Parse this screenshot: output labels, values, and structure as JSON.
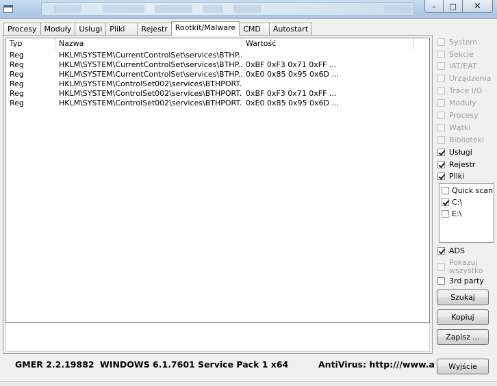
{
  "titlebar": {
    "buttons": {
      "minimize": "–",
      "maximize": "□",
      "close": "✕"
    }
  },
  "tabs": [
    {
      "label": "Procesy",
      "active": false
    },
    {
      "label": "Moduły",
      "active": false
    },
    {
      "label": "Usługi",
      "active": false
    },
    {
      "label": "Pliki",
      "active": false
    },
    {
      "label": "Rejestr",
      "active": false
    },
    {
      "label": "Rootkit/Malware",
      "active": true
    },
    {
      "label": "CMD",
      "active": false
    },
    {
      "label": "Autostart",
      "active": false
    }
  ],
  "list": {
    "columns": {
      "typ": "Typ",
      "nazwa": "Nazwa",
      "wartosc": "Wartość"
    },
    "rows": [
      {
        "typ": "Reg",
        "nazwa": "HKLM\\SYSTEM\\CurrentControlSet\\services\\BTHP...",
        "wartosc": ""
      },
      {
        "typ": "Reg",
        "nazwa": "HKLM\\SYSTEM\\CurrentControlSet\\services\\BTHP...",
        "wartosc": "0xBF 0xF3 0x71 0xFF ..."
      },
      {
        "typ": "Reg",
        "nazwa": "HKLM\\SYSTEM\\CurrentControlSet\\services\\BTHP...",
        "wartosc": "0xE0 0x85 0x95 0x6D ..."
      },
      {
        "typ": "Reg",
        "nazwa": "HKLM\\SYSTEM\\ControlSet002\\services\\BTHPORT...",
        "wartosc": ""
      },
      {
        "typ": "Reg",
        "nazwa": "HKLM\\SYSTEM\\ControlSet002\\services\\BTHPORT...",
        "wartosc": "0xBF 0xF3 0x71 0xFF ..."
      },
      {
        "typ": "Reg",
        "nazwa": "HKLM\\SYSTEM\\ControlSet002\\services\\BTHPORT...",
        "wartosc": "0xE0 0x85 0x95 0x6D ..."
      }
    ]
  },
  "options": [
    {
      "label": "System",
      "checked": false,
      "enabled": false
    },
    {
      "label": "Sekcje",
      "checked": false,
      "enabled": false
    },
    {
      "label": "IAT/EAT",
      "checked": false,
      "enabled": false
    },
    {
      "label": "Urządzenia",
      "checked": false,
      "enabled": false
    },
    {
      "label": "Trace I/O",
      "checked": false,
      "enabled": false
    },
    {
      "label": "Moduły",
      "checked": false,
      "enabled": false
    },
    {
      "label": "Procesy",
      "checked": false,
      "enabled": false
    },
    {
      "label": "Wątki",
      "checked": false,
      "enabled": false
    },
    {
      "label": "Biblioteki",
      "checked": false,
      "enabled": false
    },
    {
      "label": "Usługi",
      "checked": true,
      "enabled": true
    },
    {
      "label": "Rejestr",
      "checked": true,
      "enabled": true
    },
    {
      "label": "Pliki",
      "checked": true,
      "enabled": true
    }
  ],
  "drives": [
    {
      "label": "Quick scan",
      "checked": false
    },
    {
      "label": "C:\\",
      "checked": true
    },
    {
      "label": "E:\\",
      "checked": false
    }
  ],
  "extra_options": {
    "ads": {
      "label": "ADS",
      "checked": true
    },
    "pokazuj": {
      "line1": "Pokazuj",
      "line2": "wszystko",
      "checked": false
    },
    "third_party": {
      "label": "3rd party",
      "checked": false
    }
  },
  "buttons": {
    "szukaj": "Szukaj",
    "kopiuj": "Kopiuj",
    "zapisz": "Zapisz ...",
    "wyjscie": "Wyjście"
  },
  "status": {
    "version": "GMER 2.2.19882",
    "os": "WINDOWS 6.1.7601 Service Pack 1 x64",
    "antivirus": "AntiVirus: http:///www.avast.com"
  }
}
